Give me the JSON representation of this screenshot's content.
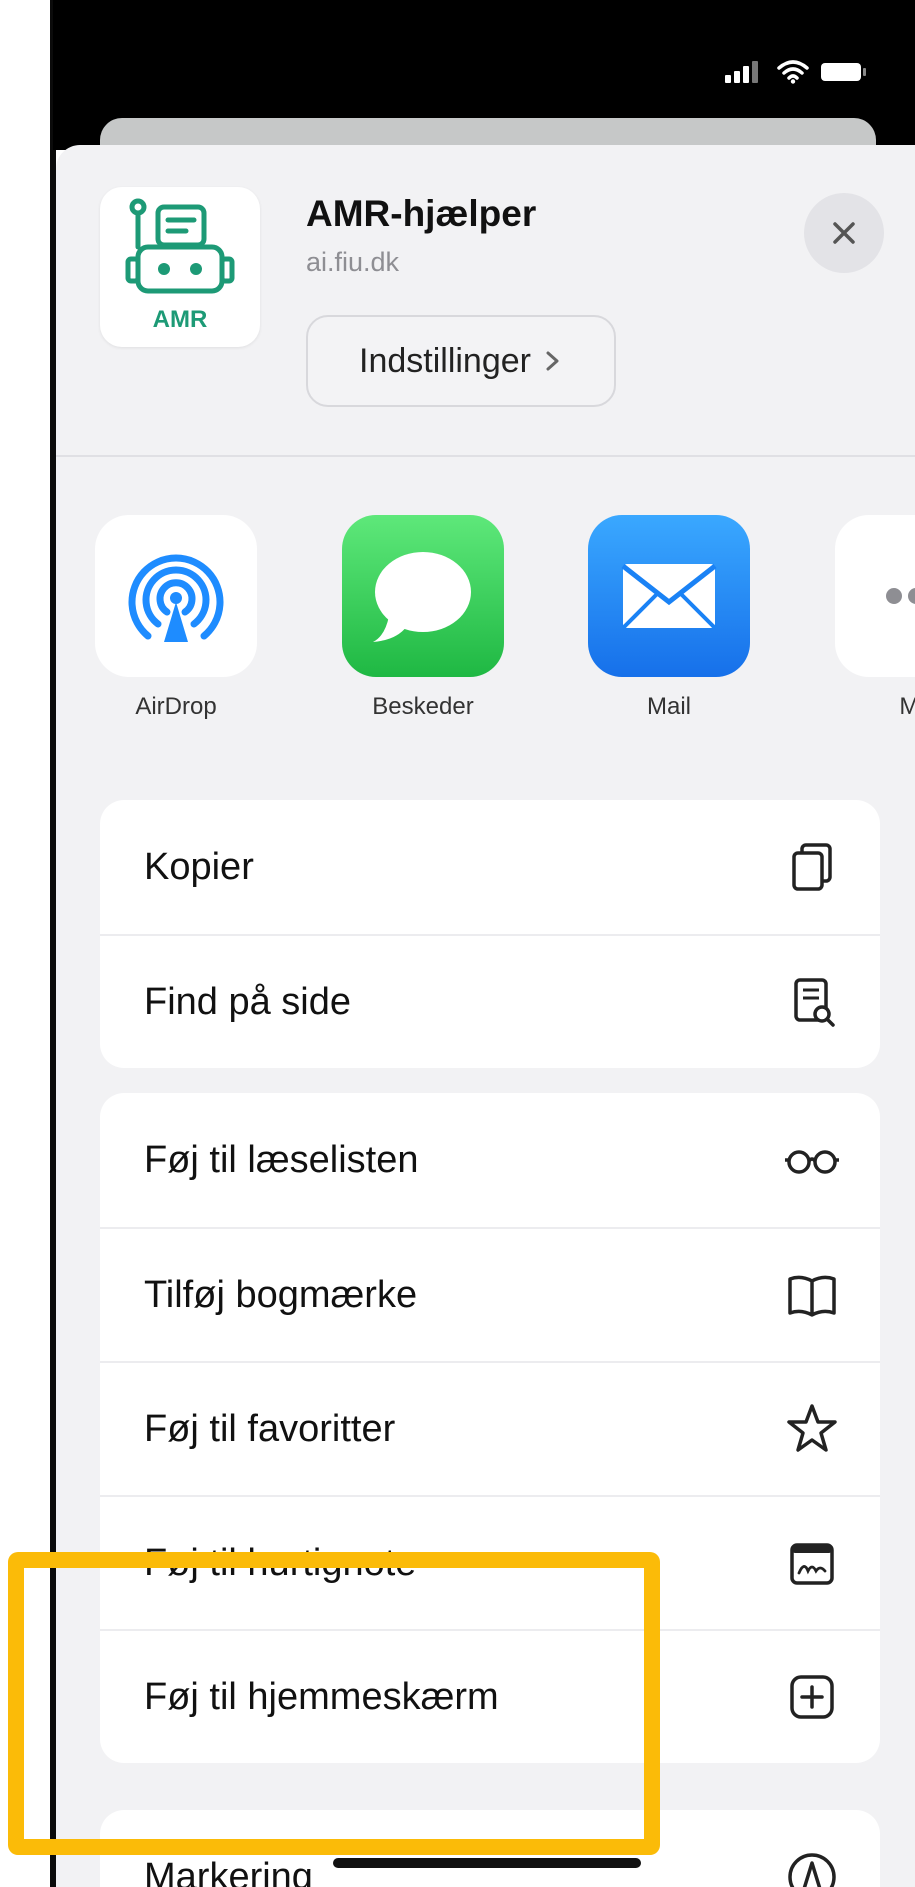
{
  "app": {
    "title": "AMR-hjælper",
    "url": "ai.fiu.dk",
    "icon_text": "AMR",
    "settings_label": "Indstillinger",
    "brand_color": "#1d9a76"
  },
  "status_bar": {
    "icons": [
      "signal-icon",
      "wifi-icon",
      "battery-icon"
    ]
  },
  "share_targets": [
    {
      "label": "AirDrop",
      "icon": "airdrop-icon"
    },
    {
      "label": "Beskeder",
      "icon": "messages-icon"
    },
    {
      "label": "Mail",
      "icon": "mail-icon"
    },
    {
      "label": "Me",
      "icon": "more-icon"
    }
  ],
  "actions_group_1": [
    {
      "label": "Kopier",
      "icon": "copy-icon"
    },
    {
      "label": "Find på side",
      "icon": "find-on-page-icon"
    }
  ],
  "actions_group_2": [
    {
      "label": "Føj til læselisten",
      "icon": "glasses-icon"
    },
    {
      "label": "Tilføj bogmærke",
      "icon": "book-icon"
    },
    {
      "label": "Føj til favoritter",
      "icon": "star-icon"
    },
    {
      "label": "Føj til hurtignote",
      "icon": "quick-note-icon"
    },
    {
      "label": "Føj til hjemmeskærm",
      "icon": "add-square-icon"
    }
  ],
  "actions_group_3": [
    {
      "label": "Markering",
      "icon": "markup-icon"
    }
  ],
  "colors": {
    "highlight": "#fbbb08",
    "sheet_bg": "#f2f2f4",
    "messages_green": "#34c759",
    "mail_blue": "#1a82f5",
    "airdrop_blue": "#1e8cff"
  }
}
